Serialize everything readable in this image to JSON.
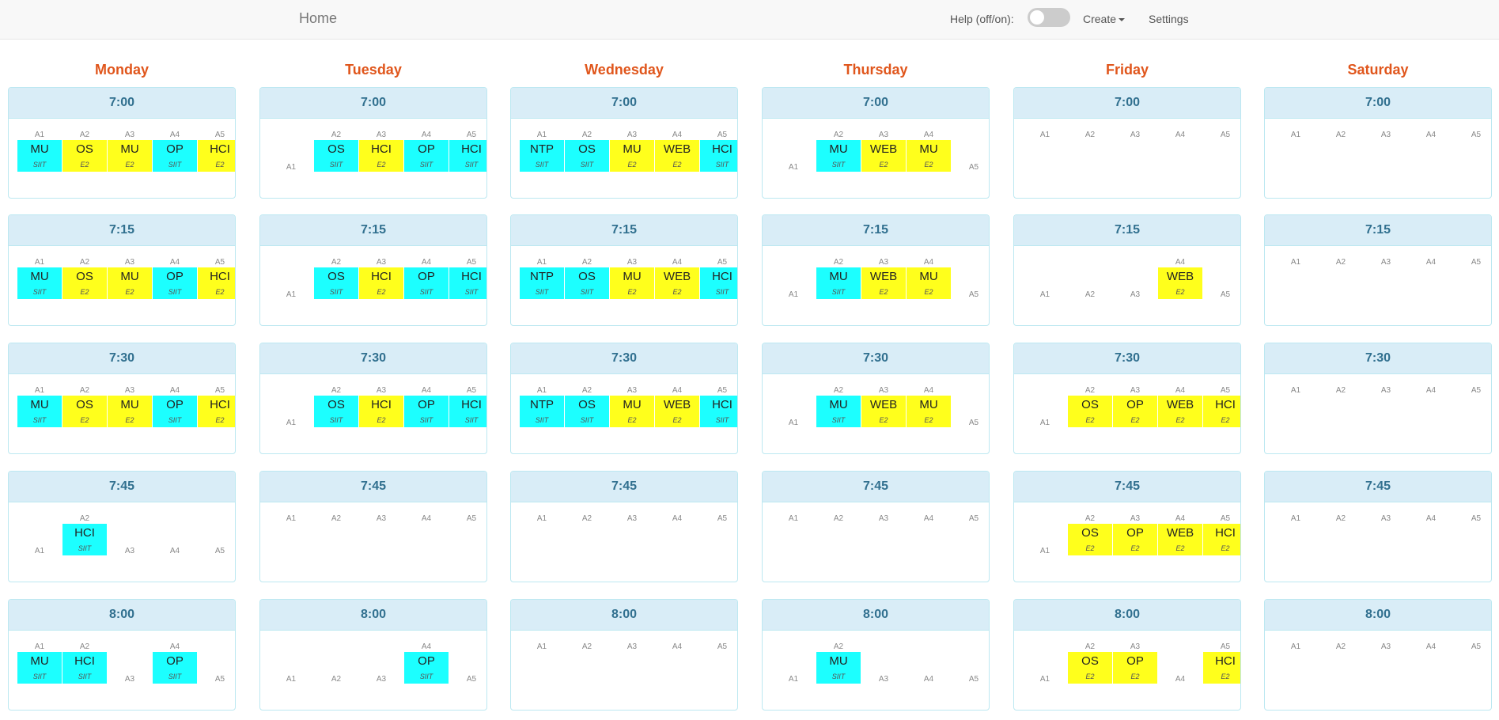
{
  "navbar": {
    "brand": "Home",
    "help_label": "Help (off/on):",
    "help_on": false,
    "create_label": "Create",
    "settings_label": "Settings"
  },
  "colors": {
    "cyan": "#1cffff",
    "yellow": "#ffff1c",
    "day": "#e0561c",
    "slot_header": "#d9edf7"
  },
  "rooms": [
    "A1",
    "A2",
    "A3",
    "A4",
    "A5"
  ],
  "days": [
    {
      "name": "Monday",
      "slots": [
        {
          "time": "7:00",
          "classes": [
            [
              "MU",
              "SIIT",
              "cyan"
            ],
            [
              "OS",
              "E2",
              "yellow"
            ],
            [
              "MU",
              "E2",
              "yellow"
            ],
            [
              "OP",
              "SIIT",
              "cyan"
            ],
            [
              "HCI",
              "E2",
              "yellow"
            ]
          ]
        },
        {
          "time": "7:15",
          "classes": [
            [
              "MU",
              "SIIT",
              "cyan"
            ],
            [
              "OS",
              "E2",
              "yellow"
            ],
            [
              "MU",
              "E2",
              "yellow"
            ],
            [
              "OP",
              "SIIT",
              "cyan"
            ],
            [
              "HCI",
              "E2",
              "yellow"
            ]
          ]
        },
        {
          "time": "7:30",
          "classes": [
            [
              "MU",
              "SIIT",
              "cyan"
            ],
            [
              "OS",
              "E2",
              "yellow"
            ],
            [
              "MU",
              "E2",
              "yellow"
            ],
            [
              "OP",
              "SIIT",
              "cyan"
            ],
            [
              "HCI",
              "E2",
              "yellow"
            ]
          ]
        },
        {
          "time": "7:45",
          "classes": [
            null,
            [
              "HCI",
              "SIIT",
              "cyan"
            ],
            null,
            null,
            null
          ]
        },
        {
          "time": "8:00",
          "classes": [
            [
              "MU",
              "SIIT",
              "cyan"
            ],
            [
              "HCI",
              "SIIT",
              "cyan"
            ],
            null,
            [
              "OP",
              "SIIT",
              "cyan"
            ],
            null
          ]
        }
      ]
    },
    {
      "name": "Tuesday",
      "slots": [
        {
          "time": "7:00",
          "classes": [
            null,
            [
              "OS",
              "SIIT",
              "cyan"
            ],
            [
              "HCI",
              "E2",
              "yellow"
            ],
            [
              "OP",
              "SIIT",
              "cyan"
            ],
            [
              "HCI",
              "SIIT",
              "cyan"
            ]
          ]
        },
        {
          "time": "7:15",
          "classes": [
            null,
            [
              "OS",
              "SIIT",
              "cyan"
            ],
            [
              "HCI",
              "E2",
              "yellow"
            ],
            [
              "OP",
              "SIIT",
              "cyan"
            ],
            [
              "HCI",
              "SIIT",
              "cyan"
            ]
          ]
        },
        {
          "time": "7:30",
          "classes": [
            null,
            [
              "OS",
              "SIIT",
              "cyan"
            ],
            [
              "HCI",
              "E2",
              "yellow"
            ],
            [
              "OP",
              "SIIT",
              "cyan"
            ],
            [
              "HCI",
              "SIIT",
              "cyan"
            ]
          ]
        },
        {
          "time": "7:45",
          "classes": [
            null,
            null,
            null,
            null,
            null
          ]
        },
        {
          "time": "8:00",
          "classes": [
            null,
            null,
            null,
            [
              "OP",
              "SIIT",
              "cyan"
            ],
            null
          ]
        }
      ]
    },
    {
      "name": "Wednesday",
      "slots": [
        {
          "time": "7:00",
          "classes": [
            [
              "NTP",
              "SIIT",
              "cyan"
            ],
            [
              "OS",
              "SIIT",
              "cyan"
            ],
            [
              "MU",
              "E2",
              "yellow"
            ],
            [
              "WEB",
              "E2",
              "yellow"
            ],
            [
              "HCI",
              "SIIT",
              "cyan"
            ]
          ]
        },
        {
          "time": "7:15",
          "classes": [
            [
              "NTP",
              "SIIT",
              "cyan"
            ],
            [
              "OS",
              "SIIT",
              "cyan"
            ],
            [
              "MU",
              "E2",
              "yellow"
            ],
            [
              "WEB",
              "E2",
              "yellow"
            ],
            [
              "HCI",
              "SIIT",
              "cyan"
            ]
          ]
        },
        {
          "time": "7:30",
          "classes": [
            [
              "NTP",
              "SIIT",
              "cyan"
            ],
            [
              "OS",
              "SIIT",
              "cyan"
            ],
            [
              "MU",
              "E2",
              "yellow"
            ],
            [
              "WEB",
              "E2",
              "yellow"
            ],
            [
              "HCI",
              "SIIT",
              "cyan"
            ]
          ]
        },
        {
          "time": "7:45",
          "classes": [
            null,
            null,
            null,
            null,
            null
          ]
        },
        {
          "time": "8:00",
          "classes": [
            null,
            null,
            null,
            null,
            null
          ]
        }
      ]
    },
    {
      "name": "Thursday",
      "slots": [
        {
          "time": "7:00",
          "classes": [
            null,
            [
              "MU",
              "SIIT",
              "cyan"
            ],
            [
              "WEB",
              "E2",
              "yellow"
            ],
            [
              "MU",
              "E2",
              "yellow"
            ],
            null
          ]
        },
        {
          "time": "7:15",
          "classes": [
            null,
            [
              "MU",
              "SIIT",
              "cyan"
            ],
            [
              "WEB",
              "E2",
              "yellow"
            ],
            [
              "MU",
              "E2",
              "yellow"
            ],
            null
          ]
        },
        {
          "time": "7:30",
          "classes": [
            null,
            [
              "MU",
              "SIIT",
              "cyan"
            ],
            [
              "WEB",
              "E2",
              "yellow"
            ],
            [
              "MU",
              "E2",
              "yellow"
            ],
            null
          ]
        },
        {
          "time": "7:45",
          "classes": [
            null,
            null,
            null,
            null,
            null
          ]
        },
        {
          "time": "8:00",
          "classes": [
            null,
            [
              "MU",
              "SIIT",
              "cyan"
            ],
            null,
            null,
            null
          ]
        }
      ]
    },
    {
      "name": "Friday",
      "slots": [
        {
          "time": "7:00",
          "classes": [
            null,
            null,
            null,
            null,
            null
          ]
        },
        {
          "time": "7:15",
          "classes": [
            null,
            null,
            null,
            [
              "WEB",
              "E2",
              "yellow"
            ],
            null
          ]
        },
        {
          "time": "7:30",
          "classes": [
            null,
            [
              "OS",
              "E2",
              "yellow"
            ],
            [
              "OP",
              "E2",
              "yellow"
            ],
            [
              "WEB",
              "E2",
              "yellow"
            ],
            [
              "HCI",
              "E2",
              "yellow"
            ]
          ]
        },
        {
          "time": "7:45",
          "classes": [
            null,
            [
              "OS",
              "E2",
              "yellow"
            ],
            [
              "OP",
              "E2",
              "yellow"
            ],
            [
              "WEB",
              "E2",
              "yellow"
            ],
            [
              "HCI",
              "E2",
              "yellow"
            ]
          ]
        },
        {
          "time": "8:00",
          "classes": [
            null,
            [
              "OS",
              "E2",
              "yellow"
            ],
            [
              "OP",
              "E2",
              "yellow"
            ],
            null,
            [
              "HCI",
              "E2",
              "yellow"
            ]
          ]
        }
      ]
    },
    {
      "name": "Saturday",
      "slots": [
        {
          "time": "7:00",
          "classes": [
            null,
            null,
            null,
            null,
            null
          ]
        },
        {
          "time": "7:15",
          "classes": [
            null,
            null,
            null,
            null,
            null
          ]
        },
        {
          "time": "7:30",
          "classes": [
            null,
            null,
            null,
            null,
            null
          ]
        },
        {
          "time": "7:45",
          "classes": [
            null,
            null,
            null,
            null,
            null
          ]
        },
        {
          "time": "8:00",
          "classes": [
            null,
            null,
            null,
            null,
            null
          ]
        }
      ]
    }
  ]
}
